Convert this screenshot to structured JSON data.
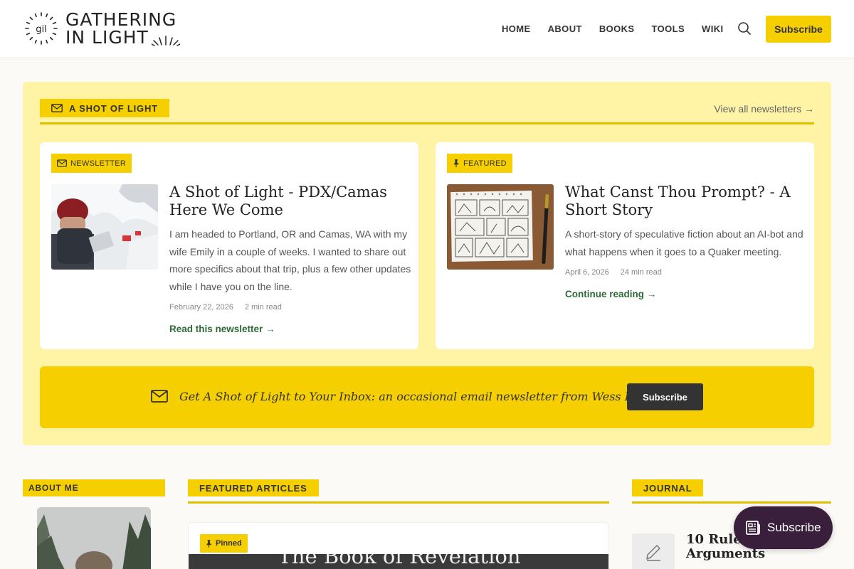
{
  "header": {
    "logo_mark": "gil",
    "logo_line1": "GATHERING",
    "logo_line2": "IN LIGHT",
    "nav": [
      "HOME",
      "ABOUT",
      "BOOKS",
      "TOOLS",
      "WIKI"
    ],
    "subscribe_label": "Subscribe"
  },
  "newsletter_panel": {
    "tag": "A SHOT OF LIGHT",
    "view_all": "View all newsletters →",
    "cards": [
      {
        "badge": "NEWSLETTER",
        "title": "A Shot of Light - PDX/Camas Here We Come",
        "excerpt": "I am headed to Portland, OR and Camas, WA with my wife Emily in a couple of weeks. I wanted to share out more specifics about that trip, plus a few other updates while I have you on the line.",
        "date": "February 22, 2026",
        "read_time": "2 min read",
        "link": "Read this newsletter →"
      },
      {
        "badge": "FEATURED",
        "title": "What Canst Thou Prompt? - A Short Story",
        "excerpt": "A short-story of speculative fiction about an AI-bot and what happens when it goes to a Quaker meeting.",
        "date": "April 6, 2026",
        "read_time": "24 min read",
        "link": "Continue reading →"
      }
    ],
    "cta_text": "Get A Shot of Light to Your Inbox: an occasional email newsletter from Wess Daniels",
    "cta_button": "Subscribe"
  },
  "about": {
    "tag": "ABOUT ME"
  },
  "featured": {
    "tag": "FEATURED ARTICLES",
    "pinned_label": "Pinned",
    "image_text": "The Book of Revelation"
  },
  "journal": {
    "tag": "JOURNAL",
    "first_title": "10 Rules for Bro Arguments"
  },
  "floating_subscribe": "Subscribe",
  "colors": {
    "accent": "#f5cf00",
    "panel": "#fff3a6",
    "link_green": "#2f6b36",
    "float_bg": "#3a1f3d"
  }
}
